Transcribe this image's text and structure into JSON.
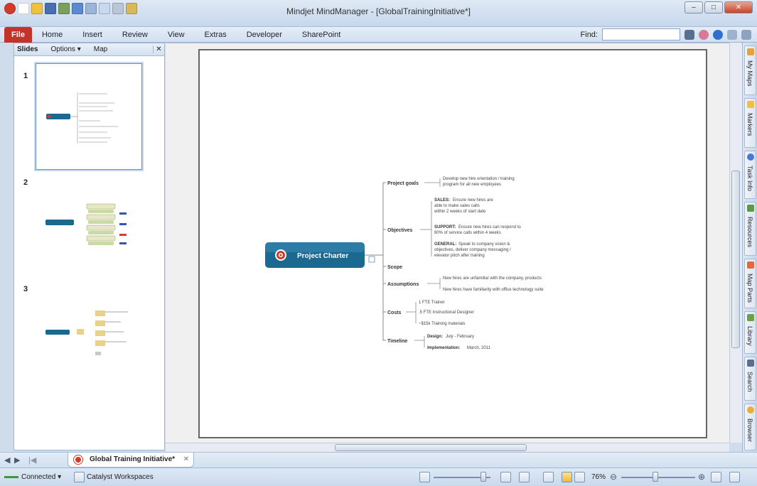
{
  "window": {
    "title": "Mindjet MindManager - [GlobalTrainingInitiative*]",
    "minimize": "–",
    "maximize": "□",
    "close": "✕"
  },
  "ribbon": {
    "tabs": [
      "File",
      "Home",
      "Insert",
      "Review",
      "View",
      "Extras",
      "Developer",
      "SharePoint"
    ],
    "find_label": "Find:",
    "find_value": ""
  },
  "slides_panel": {
    "title": "Slides",
    "options": "Options ▾",
    "map": "Map",
    "close": "✕",
    "slides": [
      {
        "number": "1"
      },
      {
        "number": "2"
      },
      {
        "number": "3"
      }
    ]
  },
  "mindmap": {
    "central": "Project Charter",
    "topics": {
      "goals": "Project goals",
      "goals_sub": [
        "Develop new hire orientation / training",
        "program for all new employees"
      ],
      "objectives": "Objectives",
      "sales_label": "SALES:",
      "sales_text": [
        "Ensure new hires are",
        "able to make sales calls",
        "within 2 weeks of start date"
      ],
      "support_label": "SUPPORT:",
      "support_text": [
        "Ensure new hires can respond to",
        "80% of service calls within 4 weeks"
      ],
      "general_label": "GENERAL:",
      "general_text": [
        "Speak to company vision &",
        "objectives, deliver company messaging /",
        "elevator pitch after training"
      ],
      "scope": "Scope",
      "assumptions": "Assumptions",
      "assumptions_sub": [
        "New hires are unfamiliar with the company, products",
        "New hires have familiarity with office technology suite"
      ],
      "costs": "Costs",
      "costs_sub": [
        "1 FTE Trainer",
        ".5 FTE Instructional Designer",
        "~$15k Training materials"
      ],
      "timeline": "Timeline",
      "design_label": "Design:",
      "design_text": "July - February",
      "impl_label": "Implementation:",
      "impl_text": "March, 2011"
    }
  },
  "right_tabs": [
    "My Maps",
    "Markers",
    "Task Info",
    "Resources",
    "Map Parts",
    "Library",
    "Search",
    "Browser"
  ],
  "doc_tab": {
    "label": "Global Training Initiative*",
    "close": "✕"
  },
  "status": {
    "connected": "Connected ▾",
    "workspaces": "Catalyst Workspaces",
    "zoom": "76%"
  },
  "colors": {
    "accent": "#1d6f9a",
    "file_tab": "#c5322a",
    "central_topic": "#1b6890"
  }
}
